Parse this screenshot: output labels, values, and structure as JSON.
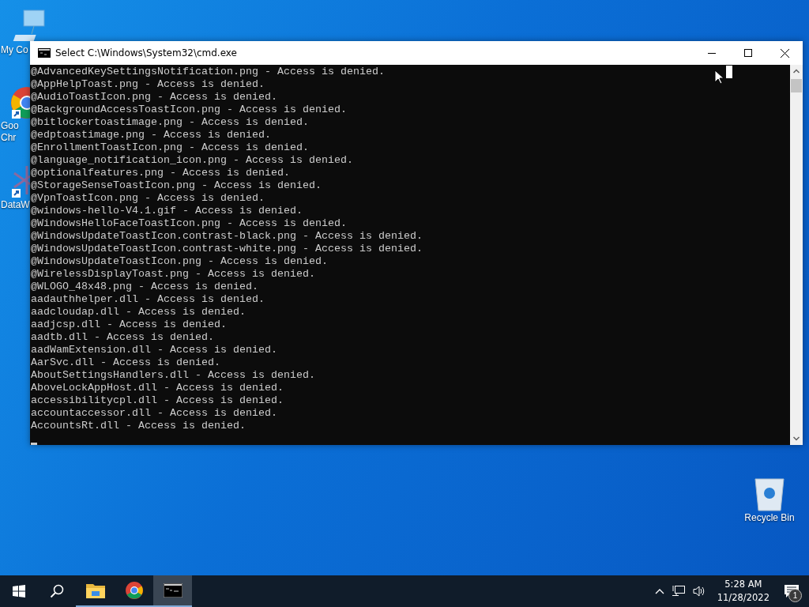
{
  "desktop_icons": [
    {
      "kind": "computer",
      "label": [
        "My Co"
      ]
    },
    {
      "kind": "chrome",
      "label": [
        "Goo",
        "Chr"
      ],
      "shortcut": true
    },
    {
      "kind": "dataw",
      "label": [
        "DataW"
      ],
      "shortcut": true
    },
    {
      "kind": "recycle-bin",
      "label": [
        "Recycle Bin"
      ]
    }
  ],
  "window": {
    "title": "Select C:\\Windows\\System32\\cmd.exe",
    "lines": [
      "@AdvancedKeySettingsNotification.png - Access is denied.",
      "@AppHelpToast.png - Access is denied.",
      "@AudioToastIcon.png - Access is denied.",
      "@BackgroundAccessToastIcon.png - Access is denied.",
      "@bitlockertoastimage.png - Access is denied.",
      "@edptoastimage.png - Access is denied.",
      "@EnrollmentToastIcon.png - Access is denied.",
      "@language_notification_icon.png - Access is denied.",
      "@optionalfeatures.png - Access is denied.",
      "@StorageSenseToastIcon.png - Access is denied.",
      "@VpnToastIcon.png - Access is denied.",
      "@windows-hello-V4.1.gif - Access is denied.",
      "@WindowsHelloFaceToastIcon.png - Access is denied.",
      "@WindowsUpdateToastIcon.contrast-black.png - Access is denied.",
      "@WindowsUpdateToastIcon.contrast-white.png - Access is denied.",
      "@WindowsUpdateToastIcon.png - Access is denied.",
      "@WirelessDisplayToast.png - Access is denied.",
      "@WLOGO_48x48.png - Access is denied.",
      "aadauthhelper.dll - Access is denied.",
      "aadcloudap.dll - Access is denied.",
      "aadjcsp.dll - Access is denied.",
      "aadtb.dll - Access is denied.",
      "aadWamExtension.dll - Access is denied.",
      "AarSvc.dll - Access is denied.",
      "AboutSettingsHandlers.dll - Access is denied.",
      "AboveLockAppHost.dll - Access is denied.",
      "accessibilitycpl.dll - Access is denied.",
      "accountaccessor.dll - Access is denied.",
      "AccountsRt.dll - Access is denied."
    ]
  },
  "taskbar": {
    "apps": [
      {
        "kind": "file-explorer",
        "running": true,
        "selected": false
      },
      {
        "kind": "chrome",
        "running": true,
        "selected": false
      },
      {
        "kind": "cmd",
        "running": true,
        "selected": true
      }
    ],
    "clock": {
      "time": "5:28 AM",
      "date": "11/28/2022"
    },
    "notification_count": "1"
  }
}
